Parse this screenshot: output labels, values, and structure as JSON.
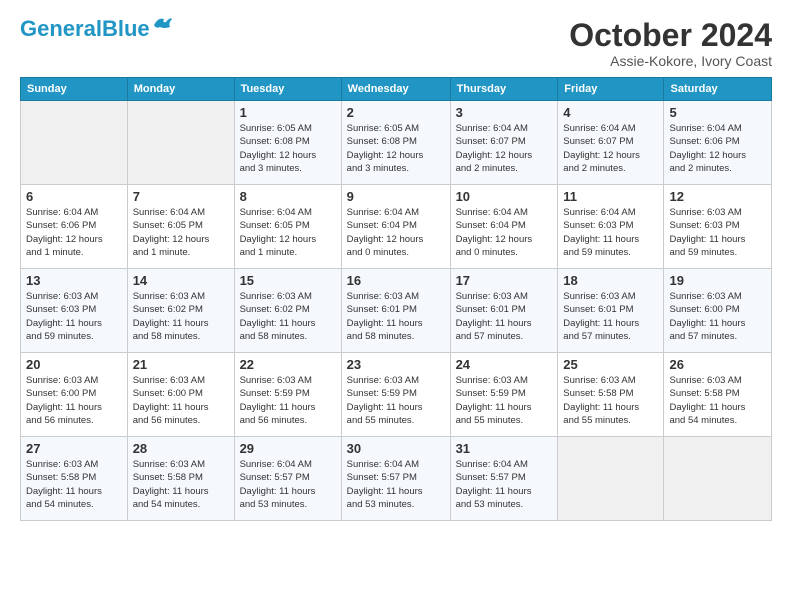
{
  "header": {
    "logo_general": "General",
    "logo_blue": "Blue",
    "month_title": "October 2024",
    "subtitle": "Assie-Kokore, Ivory Coast"
  },
  "calendar": {
    "days_of_week": [
      "Sunday",
      "Monday",
      "Tuesday",
      "Wednesday",
      "Thursday",
      "Friday",
      "Saturday"
    ],
    "weeks": [
      [
        {
          "day": "",
          "info": ""
        },
        {
          "day": "",
          "info": ""
        },
        {
          "day": "1",
          "info": "Sunrise: 6:05 AM\nSunset: 6:08 PM\nDaylight: 12 hours\nand 3 minutes."
        },
        {
          "day": "2",
          "info": "Sunrise: 6:05 AM\nSunset: 6:08 PM\nDaylight: 12 hours\nand 3 minutes."
        },
        {
          "day": "3",
          "info": "Sunrise: 6:04 AM\nSunset: 6:07 PM\nDaylight: 12 hours\nand 2 minutes."
        },
        {
          "day": "4",
          "info": "Sunrise: 6:04 AM\nSunset: 6:07 PM\nDaylight: 12 hours\nand 2 minutes."
        },
        {
          "day": "5",
          "info": "Sunrise: 6:04 AM\nSunset: 6:06 PM\nDaylight: 12 hours\nand 2 minutes."
        }
      ],
      [
        {
          "day": "6",
          "info": "Sunrise: 6:04 AM\nSunset: 6:06 PM\nDaylight: 12 hours\nand 1 minute."
        },
        {
          "day": "7",
          "info": "Sunrise: 6:04 AM\nSunset: 6:05 PM\nDaylight: 12 hours\nand 1 minute."
        },
        {
          "day": "8",
          "info": "Sunrise: 6:04 AM\nSunset: 6:05 PM\nDaylight: 12 hours\nand 1 minute."
        },
        {
          "day": "9",
          "info": "Sunrise: 6:04 AM\nSunset: 6:04 PM\nDaylight: 12 hours\nand 0 minutes."
        },
        {
          "day": "10",
          "info": "Sunrise: 6:04 AM\nSunset: 6:04 PM\nDaylight: 12 hours\nand 0 minutes."
        },
        {
          "day": "11",
          "info": "Sunrise: 6:04 AM\nSunset: 6:03 PM\nDaylight: 11 hours\nand 59 minutes."
        },
        {
          "day": "12",
          "info": "Sunrise: 6:03 AM\nSunset: 6:03 PM\nDaylight: 11 hours\nand 59 minutes."
        }
      ],
      [
        {
          "day": "13",
          "info": "Sunrise: 6:03 AM\nSunset: 6:03 PM\nDaylight: 11 hours\nand 59 minutes."
        },
        {
          "day": "14",
          "info": "Sunrise: 6:03 AM\nSunset: 6:02 PM\nDaylight: 11 hours\nand 58 minutes."
        },
        {
          "day": "15",
          "info": "Sunrise: 6:03 AM\nSunset: 6:02 PM\nDaylight: 11 hours\nand 58 minutes."
        },
        {
          "day": "16",
          "info": "Sunrise: 6:03 AM\nSunset: 6:01 PM\nDaylight: 11 hours\nand 58 minutes."
        },
        {
          "day": "17",
          "info": "Sunrise: 6:03 AM\nSunset: 6:01 PM\nDaylight: 11 hours\nand 57 minutes."
        },
        {
          "day": "18",
          "info": "Sunrise: 6:03 AM\nSunset: 6:01 PM\nDaylight: 11 hours\nand 57 minutes."
        },
        {
          "day": "19",
          "info": "Sunrise: 6:03 AM\nSunset: 6:00 PM\nDaylight: 11 hours\nand 57 minutes."
        }
      ],
      [
        {
          "day": "20",
          "info": "Sunrise: 6:03 AM\nSunset: 6:00 PM\nDaylight: 11 hours\nand 56 minutes."
        },
        {
          "day": "21",
          "info": "Sunrise: 6:03 AM\nSunset: 6:00 PM\nDaylight: 11 hours\nand 56 minutes."
        },
        {
          "day": "22",
          "info": "Sunrise: 6:03 AM\nSunset: 5:59 PM\nDaylight: 11 hours\nand 56 minutes."
        },
        {
          "day": "23",
          "info": "Sunrise: 6:03 AM\nSunset: 5:59 PM\nDaylight: 11 hours\nand 55 minutes."
        },
        {
          "day": "24",
          "info": "Sunrise: 6:03 AM\nSunset: 5:59 PM\nDaylight: 11 hours\nand 55 minutes."
        },
        {
          "day": "25",
          "info": "Sunrise: 6:03 AM\nSunset: 5:58 PM\nDaylight: 11 hours\nand 55 minutes."
        },
        {
          "day": "26",
          "info": "Sunrise: 6:03 AM\nSunset: 5:58 PM\nDaylight: 11 hours\nand 54 minutes."
        }
      ],
      [
        {
          "day": "27",
          "info": "Sunrise: 6:03 AM\nSunset: 5:58 PM\nDaylight: 11 hours\nand 54 minutes."
        },
        {
          "day": "28",
          "info": "Sunrise: 6:03 AM\nSunset: 5:58 PM\nDaylight: 11 hours\nand 54 minutes."
        },
        {
          "day": "29",
          "info": "Sunrise: 6:04 AM\nSunset: 5:57 PM\nDaylight: 11 hours\nand 53 minutes."
        },
        {
          "day": "30",
          "info": "Sunrise: 6:04 AM\nSunset: 5:57 PM\nDaylight: 11 hours\nand 53 minutes."
        },
        {
          "day": "31",
          "info": "Sunrise: 6:04 AM\nSunset: 5:57 PM\nDaylight: 11 hours\nand 53 minutes."
        },
        {
          "day": "",
          "info": ""
        },
        {
          "day": "",
          "info": ""
        }
      ]
    ]
  }
}
